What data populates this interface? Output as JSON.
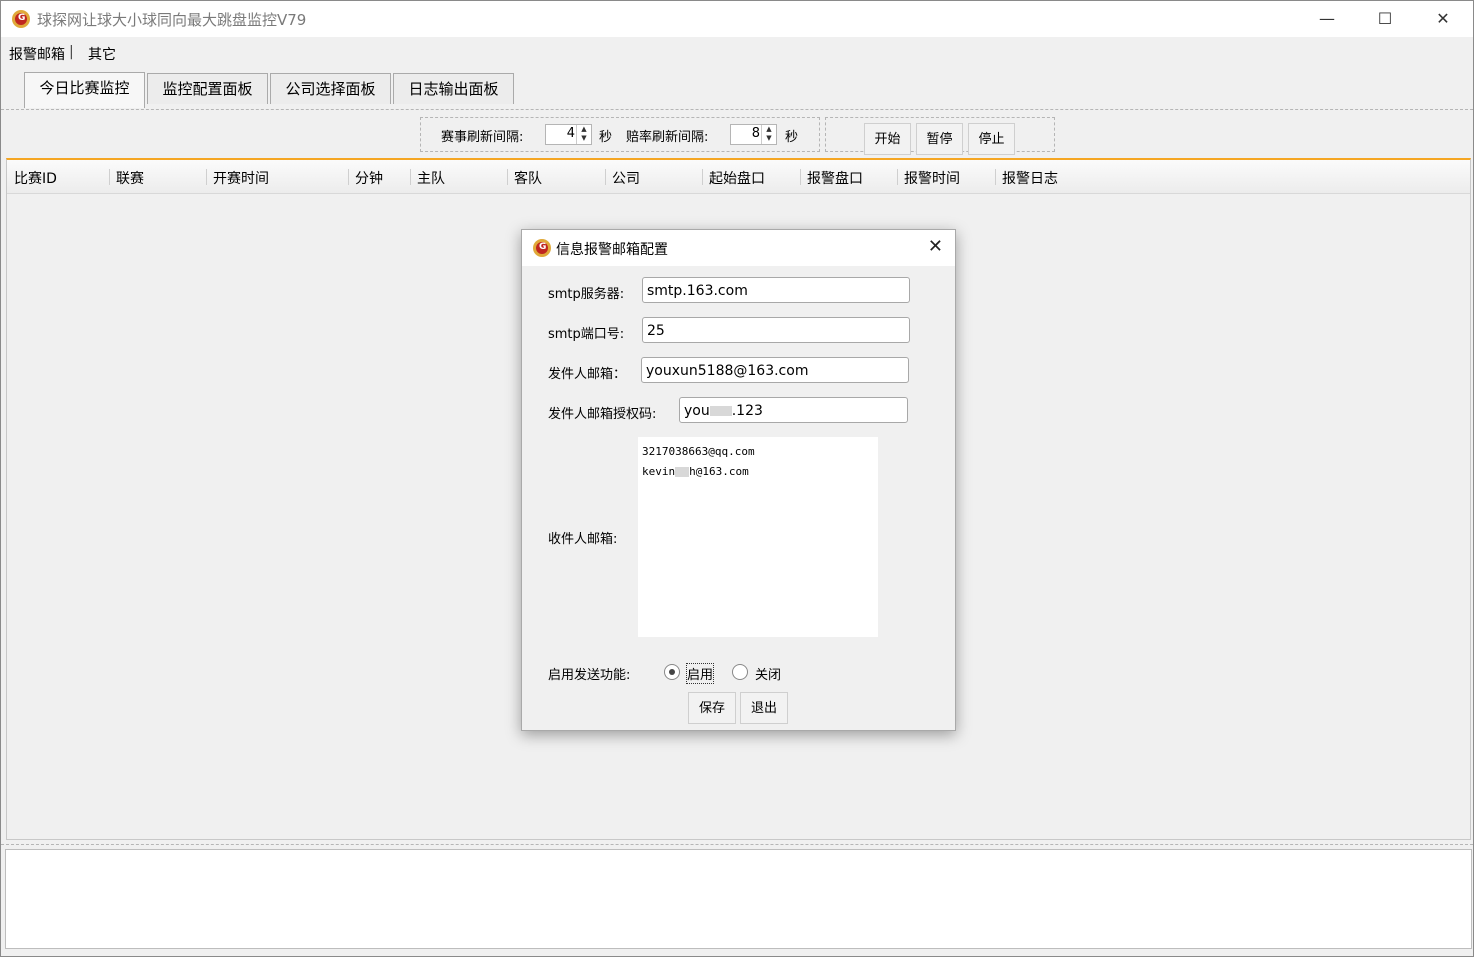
{
  "window": {
    "title": "球探网让球大小球同向最大跳盘监控V79",
    "controls": {
      "minimize": "—",
      "maximize": "☐",
      "close": "✕"
    }
  },
  "menu": [
    "报警邮箱",
    "|",
    "其它"
  ],
  "tabs": [
    "今日比赛监控",
    "监控配置面板",
    "公司选择面板",
    "日志输出面板"
  ],
  "toolbar": {
    "match_refresh_label": "赛事刷新间隔:",
    "match_refresh_value": "4",
    "match_refresh_unit": "秒",
    "odds_refresh_label": "赔率刷新间隔:",
    "odds_refresh_value": "8",
    "odds_refresh_unit": "秒",
    "start": "开始",
    "pause": "暂停",
    "stop": "停止"
  },
  "grid": {
    "columns": [
      "比赛ID",
      "联赛",
      "开赛时间",
      "分钟",
      "主队",
      "客队",
      "公司",
      "起始盘口",
      "报警盘口",
      "报警时间",
      "报警日志"
    ],
    "rows": []
  },
  "dialog": {
    "title": "信息报警邮箱配置",
    "close": "✕",
    "smtp_server_label": "smtp服务器:",
    "smtp_server_value": "smtp.163.com",
    "smtp_port_label": "smtp端口号:",
    "smtp_port_value": "25",
    "sender_label": "发件人邮箱：",
    "sender_value": "youxun5188@163.com",
    "auth_label": "发件人邮箱授权码:",
    "auth_value_prefix": "you",
    "auth_value_suffix": ".123",
    "receivers_label": "收件人邮箱:",
    "receiver_1": "3217038663@qq.com",
    "receiver_2_prefix": "kevin",
    "receiver_2_suffix": "h@163.com",
    "enable_label": "启用发送功能:",
    "enable_on": "启用",
    "enable_off": "关闭",
    "enabled_selected": "启用",
    "save": "保存",
    "exit": "退出"
  }
}
